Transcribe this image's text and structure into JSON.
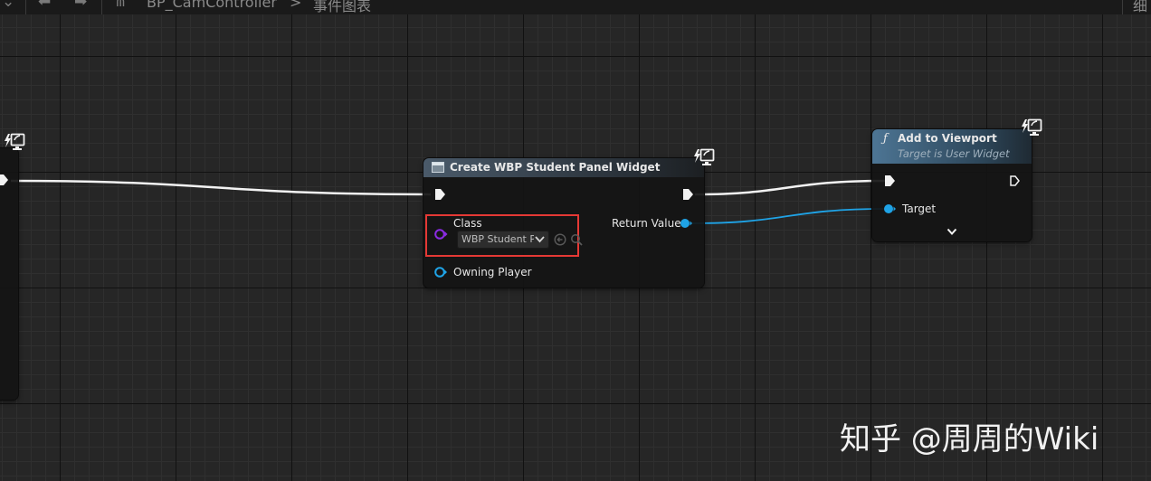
{
  "toolbar": {
    "breadcrumb_blueprint": "BP_CamController",
    "breadcrumb_separator": ">",
    "breadcrumb_graph": "事件图表",
    "right_fragment": "细"
  },
  "create_widget_node": {
    "title": "Create WBP Student Panel Widget",
    "class_label": "Class",
    "class_value": "WBP Student P.",
    "owning_player_label": "Owning Player",
    "return_value_label": "Return Value"
  },
  "add_viewport_node": {
    "function_glyph": "ƒ",
    "title": "Add to Viewport",
    "subtitle": "Target is User Widget",
    "target_label": "Target"
  },
  "colors": {
    "exec_wire": "#f2f2f2",
    "object_wire": "#1fa3e6",
    "class_pin": "#8a2be2",
    "highlight_box": "#e53935",
    "function_header": "#3b5870"
  },
  "watermark": "知乎 @周周的Wiki"
}
